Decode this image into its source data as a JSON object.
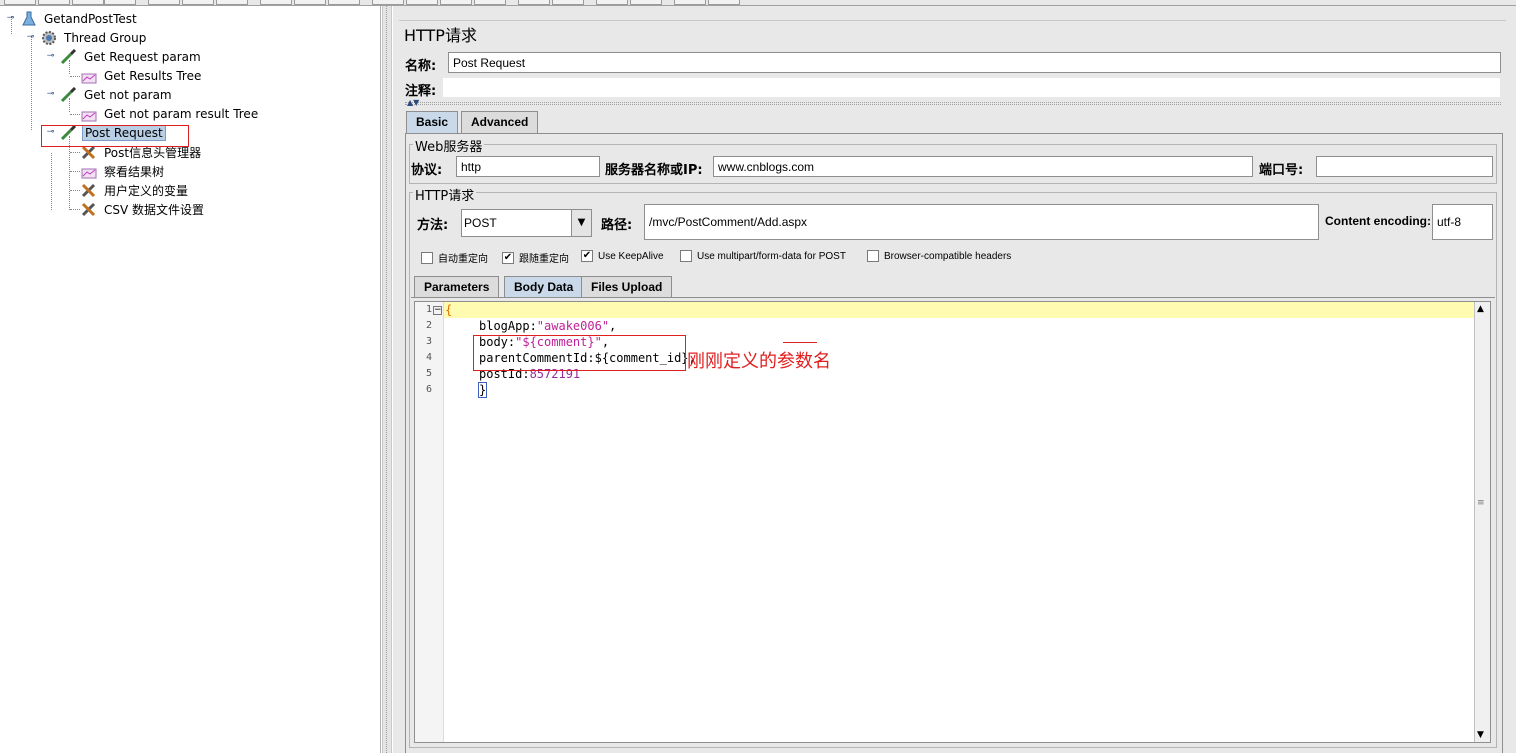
{
  "tree": {
    "items": [
      {
        "label": "GetandPostTest",
        "icon": "test-plan-flask-icon"
      },
      {
        "label": "Thread Group",
        "icon": "gear-icon"
      },
      {
        "label": "Get Request param",
        "icon": "http-sampler-dropper-icon"
      },
      {
        "label": "Get Results Tree",
        "icon": "chart-listener-icon"
      },
      {
        "label": "Get not param",
        "icon": "http-sampler-dropper-icon"
      },
      {
        "label": "Get not param result Tree",
        "icon": "chart-listener-icon"
      },
      {
        "label": "Post Request",
        "icon": "http-sampler-dropper-icon",
        "selected": true
      },
      {
        "label": "Post信息头管理器",
        "icon": "config-tools-icon"
      },
      {
        "label": "察看结果树",
        "icon": "chart-listener-icon"
      },
      {
        "label": "用户定义的变量",
        "icon": "config-tools-icon"
      },
      {
        "label": "CSV 数据文件设置",
        "icon": "config-tools-icon"
      }
    ]
  },
  "panel": {
    "title": "HTTP请求",
    "name_label": "名称:",
    "name_value": "Post Request",
    "comment_label": "注释:",
    "comment_value": ""
  },
  "tabs": {
    "basic": "Basic",
    "advanced": "Advanced"
  },
  "web_server": {
    "group_title": "Web服务器",
    "protocol_label": "协议:",
    "protocol_value": "http",
    "server_label": "服务器名称或IP:",
    "server_value": "www.cnblogs.com",
    "port_label": "端口号:",
    "port_value": ""
  },
  "http_request": {
    "group_title": "HTTP请求",
    "method_label": "方法:",
    "method_value": "POST",
    "path_label": "路径:",
    "path_value": "/mvc/PostComment/Add.aspx",
    "encoding_label": "Content encoding:",
    "encoding_value": "utf-8",
    "options": [
      {
        "label": "自动重定向",
        "checked": false
      },
      {
        "label": "跟随重定向",
        "checked": true
      },
      {
        "label": "Use KeepAlive",
        "checked": true
      },
      {
        "label": "Use multipart/form-data for POST",
        "checked": false
      },
      {
        "label": "Browser-compatible headers",
        "checked": false
      }
    ]
  },
  "sub_tabs": {
    "parameters": "Parameters",
    "body_data": "Body Data",
    "files_upload": "Files Upload"
  },
  "editor": {
    "line_numbers": [
      "1",
      "2",
      "3",
      "4",
      "5",
      "6"
    ],
    "line1": "{",
    "line2_key": "blogApp:",
    "line2_val": "\"awake006\"",
    "line2_tail": ",",
    "line3_key": "body:",
    "line3_val": "\"${comment}\"",
    "line3_tail": ",",
    "line4_key": "parentCommentId:${comment_id}",
    "line4_tail": ",",
    "line5_key": "postId:",
    "line5_val": "8572191",
    "line6": "}"
  },
  "annotation": {
    "text": "刚刚定义的参数名",
    "color": "#e02020"
  }
}
